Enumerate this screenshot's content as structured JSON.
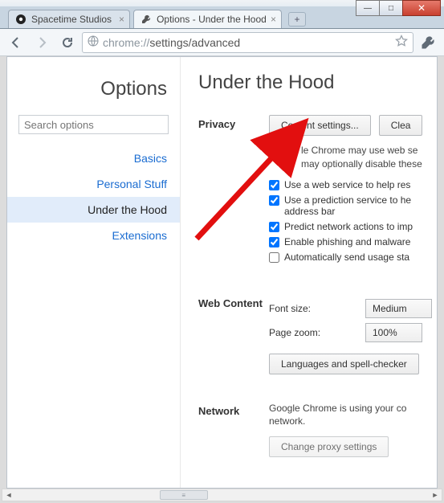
{
  "window": {
    "min": "—",
    "max": "□",
    "close": "✕"
  },
  "tabs": [
    {
      "title": "Spacetime Studios",
      "active": false
    },
    {
      "title": "Options - Under the Hood",
      "active": true
    }
  ],
  "newtab_label": "+",
  "omnibox": {
    "scheme": "chrome://",
    "host": "settings",
    "path": "/advanced"
  },
  "sidebar": {
    "title": "Options",
    "search_placeholder": "Search options",
    "items": [
      {
        "label": "Basics"
      },
      {
        "label": "Personal Stuff"
      },
      {
        "label": "Under the Hood"
      },
      {
        "label": "Extensions"
      }
    ]
  },
  "page": {
    "title": "Under the Hood",
    "privacy": {
      "label": "Privacy",
      "content_settings_btn": "Content settings...",
      "clear_btn": "Clea",
      "desc_line1": "le Chrome may use web se",
      "desc_line2": "may optionally disable these",
      "checks": [
        {
          "checked": true,
          "label": "Use a web service to help res"
        },
        {
          "checked": true,
          "label": "Use a prediction service to help complete searches and URLs typed in the address bar",
          "multiline_top": "Use a prediction service to he",
          "multiline_bottom": "address bar"
        },
        {
          "checked": true,
          "label": "Predict network actions to imp"
        },
        {
          "checked": true,
          "label": "Enable phishing and malware"
        },
        {
          "checked": false,
          "label": "Automatically send usage sta"
        }
      ]
    },
    "webcontent": {
      "label": "Web Content",
      "font_label": "Font size:",
      "font_value": "Medium",
      "zoom_label": "Page zoom:",
      "zoom_value": "100%",
      "lang_btn": "Languages and spell-checker"
    },
    "network": {
      "label": "Network",
      "desc": "Google Chrome is using your computer's system proxy settings to connect to the network.",
      "desc_visible_top": "Google Chrome is using your co",
      "desc_visible_bottom": "network.",
      "proxy_btn": "Change proxy settings"
    }
  }
}
